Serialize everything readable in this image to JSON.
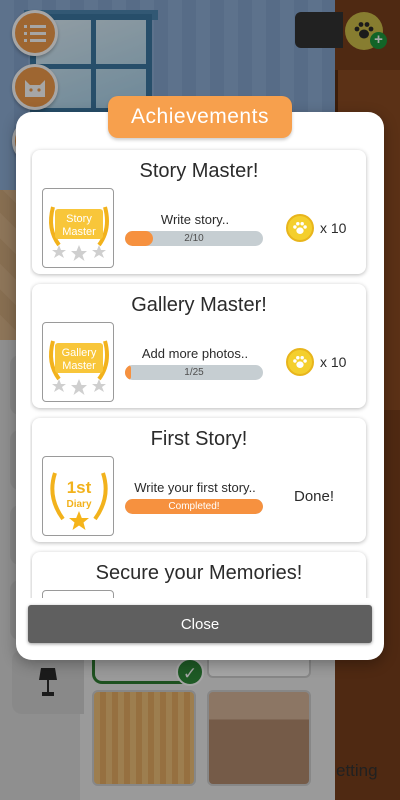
{
  "modal": {
    "title": "Achievements",
    "close_label": "Close",
    "achievements": [
      {
        "title": "Story Master!",
        "badge_text_1": "Story",
        "badge_text_2": "Master",
        "description": "Write story..",
        "progress_text": "2/10",
        "progress": 0.2,
        "reward": "x 10"
      },
      {
        "title": "Gallery Master!",
        "badge_text_1": "Gallery",
        "badge_text_2": "Master",
        "description": "Add more photos..",
        "progress_text": "1/25",
        "progress": 0.04,
        "reward": "x 10"
      },
      {
        "title": "First Story!",
        "badge_text_1": "1st",
        "badge_text_2": "Diary",
        "description": "Write your first story..",
        "progress_text": "Completed!",
        "progress": 1.0,
        "status": "Done!"
      },
      {
        "title": "Secure your Memories!"
      }
    ]
  },
  "background": {
    "setting_label": "etting"
  },
  "colors": {
    "accent": "#f7a04d",
    "progress_fill": "#f6913f",
    "progress_track": "#c6ced2",
    "coin": "#f4cf2d",
    "close_button": "#5f5f5f"
  },
  "icons": [
    "list-icon",
    "cat-icon",
    "paw-coin-icon",
    "plus-icon",
    "lamp-icon",
    "check-icon",
    "laurel-badge-icon",
    "star-icon"
  ]
}
